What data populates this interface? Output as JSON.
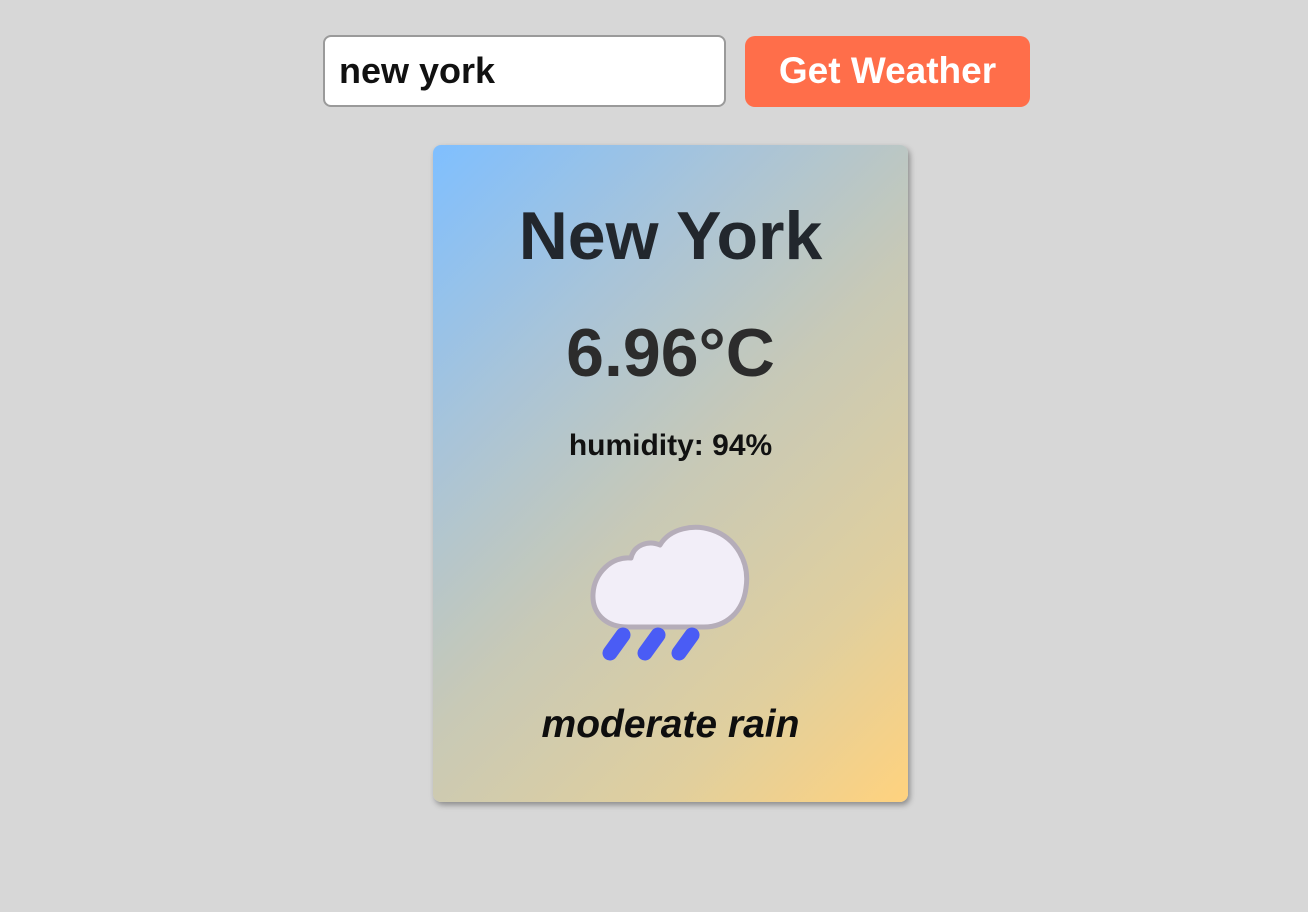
{
  "search": {
    "value": "new york",
    "button_label": "Get Weather"
  },
  "weather": {
    "city": "New York",
    "temperature": "6.96°C",
    "humidity": "humidity: 94%",
    "description": "moderate rain",
    "icon": "rain-cloud-icon"
  },
  "colors": {
    "page_background": "#d7d7d7",
    "button": "#ff6e4a",
    "button_text": "#ffffff",
    "card_gradient_start": "#7fbfff",
    "card_gradient_end": "#ffd27e",
    "rain_drops": "#4a5cf5",
    "cloud_fill": "#f2eef8",
    "cloud_stroke": "#b5adb9"
  }
}
